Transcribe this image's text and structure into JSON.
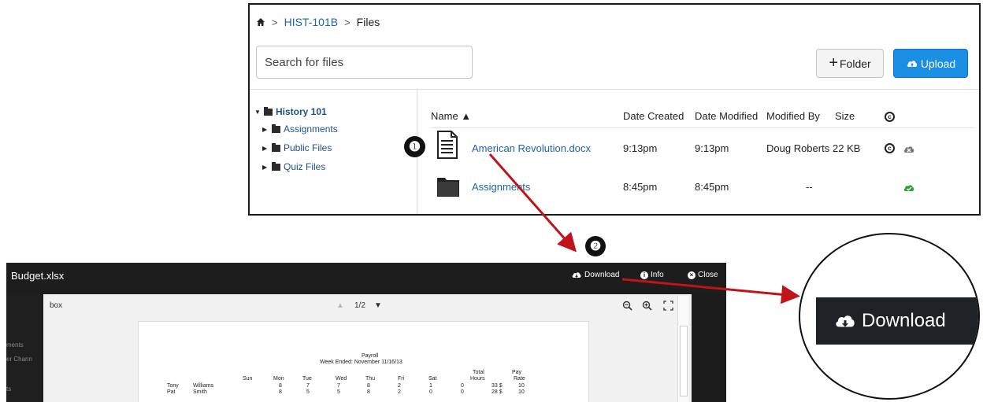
{
  "breadcrumb": {
    "home": "home-icon",
    "course": "HIST-101B",
    "current": "Files",
    "separator": ">"
  },
  "search": {
    "placeholder": "Search for files",
    "value": ""
  },
  "toolbar": {
    "folder_plus": "+",
    "folder_label": "Folder",
    "upload_label": "Upload"
  },
  "tree": {
    "root": "History 101",
    "children": [
      "Assignments",
      "Public Files",
      "Quiz Files"
    ]
  },
  "columns": {
    "name": "Name ▲",
    "date_created": "Date Created",
    "date_modified": "Date Modified",
    "modified_by": "Modified By",
    "size": "Size",
    "copyright": "c"
  },
  "files": [
    {
      "name": "American Revolution.docx",
      "date_created": "9:13pm",
      "date_modified": "9:13pm",
      "modified_by": "Doug Roberts",
      "size": "22 KB",
      "copyright": "c"
    },
    {
      "name": "Assignments",
      "date_created": "8:45pm",
      "date_modified": "8:45pm",
      "modified_by": "--",
      "size": ""
    }
  ],
  "markers": {
    "one": "❶",
    "two": "❷"
  },
  "preview": {
    "title": "Budget.xlsx",
    "download": "Download",
    "info": "Info",
    "close": "Close",
    "search_text": "box",
    "page_indicator": "1/2",
    "left_strip": [
      "ments",
      "er Chann",
      "ts"
    ],
    "sheet": {
      "title": "Payroll",
      "subtitle": "Week Ended: November 11/16/13",
      "header_top": [
        "Total",
        "Pay"
      ],
      "days": [
        "Sun",
        "Mon",
        "Tue",
        "Wed",
        "Thu",
        "Fri",
        "Sat",
        "Hours",
        "Rate"
      ],
      "rows": [
        {
          "first": "Tony",
          "last": "Williams",
          "values": [
            "8",
            "7",
            "7",
            "8",
            "2",
            "1",
            "0",
            "33 $",
            "10"
          ]
        },
        {
          "first": "Pat",
          "last": "Smith",
          "values": [
            "8",
            "5",
            "5",
            "8",
            "2",
            "0",
            "0",
            "28 $",
            "10"
          ]
        }
      ]
    }
  },
  "zoom": {
    "label": "Download"
  },
  "colors": {
    "link": "#1e63a8",
    "upload_bg": "#1a8fe3",
    "arrow": "#c0141a",
    "preview_bg": "#1d1d1d"
  }
}
